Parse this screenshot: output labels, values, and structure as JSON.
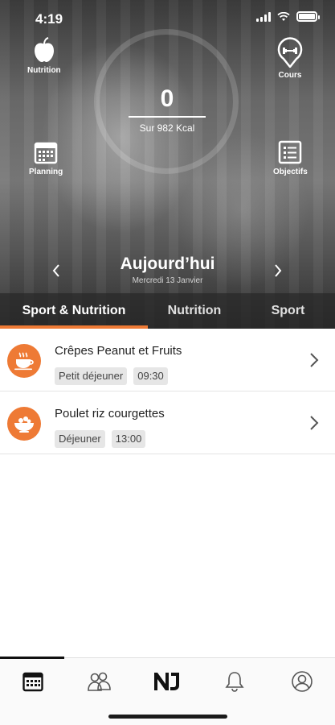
{
  "status_bar": {
    "time": "4:19"
  },
  "hero": {
    "shortcuts": {
      "nutrition": "Nutrition",
      "courses": "Cours",
      "planning": "Planning",
      "goals": "Objectifs"
    },
    "kcal_value": "0",
    "kcal_subtitle": "Sur 982 Kcal",
    "date_title": "Aujourd’hui",
    "date_subtitle": "Mercredi 13 Janvier"
  },
  "tabs": [
    {
      "label": "Sport & Nutrition",
      "active": true
    },
    {
      "label": "Nutrition",
      "active": false
    },
    {
      "label": "Sport",
      "active": false
    }
  ],
  "meals": [
    {
      "title": "Crêpes Peanut et Fruits",
      "meal_type": "Petit déjeuner",
      "time": "09:30",
      "icon": "coffee-cup-icon"
    },
    {
      "title": "Poulet riz courgettes",
      "meal_type": "Déjeuner",
      "time": "13:00",
      "icon": "salad-bowl-icon"
    }
  ],
  "tabbar": {
    "items": [
      "calendar-icon",
      "community-icon",
      "nj-logo",
      "bell-icon",
      "profile-icon"
    ],
    "active_index": 0
  },
  "colors": {
    "accent": "#ee7a35",
    "tab_bar_bg": "#fafafa"
  }
}
